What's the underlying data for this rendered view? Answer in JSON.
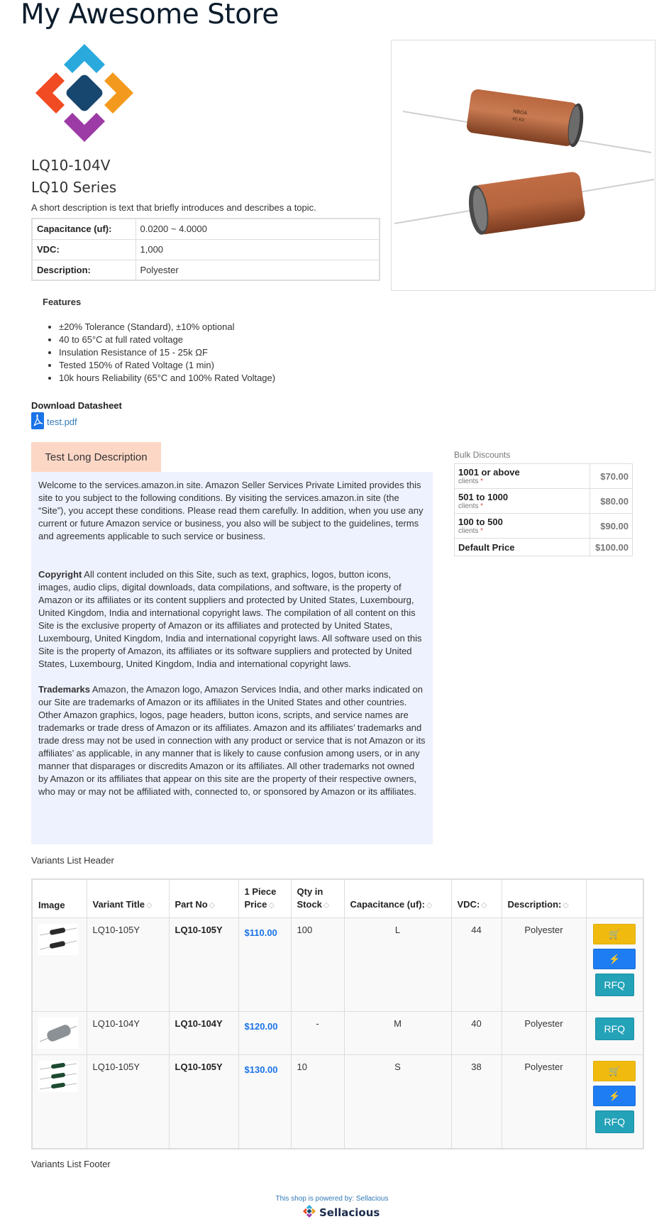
{
  "store": {
    "title": "My Awesome Store"
  },
  "product": {
    "name": "LQ10-104V",
    "series": "LQ10 Series",
    "short_description": "A short description is text that briefly introduces and describes a topic.",
    "attributes": [
      {
        "label": "Capacitance (uf):",
        "value": "0.0200 ~ 4.0000"
      },
      {
        "label": "VDC:",
        "value": "1,000"
      },
      {
        "label": "Description:",
        "value": "Polyester"
      }
    ]
  },
  "features": {
    "title": "Features",
    "items": [
      "±20% Tolerance (Standard), ±10% optional",
      "40 to 65°C at full rated voltage",
      "Insulation Resistance of 15 - 25k ΩF",
      "Tested 150% of Rated Voltage (1 min)",
      "10k hours Reliability (65°C and 100% Rated Voltage)"
    ]
  },
  "datasheet": {
    "title": "Download Datasheet",
    "file": "test.pdf"
  },
  "long_description": {
    "tab": "Test Long Description",
    "intro": "Welcome to the services.amazon.in site. Amazon Seller Services Private Limited provides this site to you subject to the following conditions. By visiting the services.amazon.in site (the “Site”), you accept these conditions. Please read them carefully. In addition, when you use any current or future Amazon service or business, you also will be subject to the guidelines, terms and agreements applicable to such service or business.",
    "copyright_label": "Copyright",
    "copyright_text": " All content included on this Site, such as text, graphics, logos, button icons, images, audio clips, digital downloads, data compilations, and software, is the property of Amazon or its affiliates or its content suppliers and protected by United States, Luxembourg, United Kingdom, India and international copyright laws. The compilation of all content on this Site is the exclusive property of Amazon or its affiliates and protected by United States, Luxembourg, United Kingdom, India and international copyright laws. All software used on this Site is the property of Amazon, its affiliates or its software suppliers and protected by United States, Luxembourg, United Kingdom, India and international copyright laws.",
    "trademarks_label": "Trademarks",
    "trademarks_text": " Amazon, the Amazon logo, Amazon Services India, and other marks indicated on our Site are trademarks of Amazon or its affiliates in the United States and other countries. Other Amazon graphics, logos, page headers, button icons, scripts, and service names are trademarks or trade dress of Amazon or its affiliates. Amazon and its affiliates’ trademarks and trade dress may not be used in connection with any product or service that is not Amazon or its affiliates’ as applicable, in any manner that is likely to cause confusion among users, or in any manner that disparages or discredits Amazon or its affiliates. All other trademarks not owned by Amazon or its affiliates that appear on this site are the property of their respective owners, who may or may not be affiliated with, connected to, or sponsored by Amazon or its affiliates."
  },
  "bulk": {
    "title": "Bulk Discounts",
    "sub_label": "clients",
    "rows": [
      {
        "qty": "1001 or above",
        "price": "$70.00"
      },
      {
        "qty": "501 to 1000",
        "price": "$80.00"
      },
      {
        "qty": "100 to 500",
        "price": "$90.00"
      }
    ],
    "default_label": "Default Price",
    "default_price": "$100.00"
  },
  "variants": {
    "header_text": "Variants List Header",
    "footer_text": "Variants List Footer",
    "columns": {
      "image": "Image",
      "title": "Variant Title",
      "part": "Part No",
      "price_line1": "1 Piece",
      "price_line2": "Price",
      "qty_line1": "Qty in",
      "qty_line2": "Stock",
      "cap": "Capacitance (uf):",
      "vdc": "VDC:",
      "desc": "Description:"
    },
    "rfq_label": "RFQ",
    "rows": [
      {
        "title": "LQ10-105Y",
        "part": "LQ10-105Y",
        "price": "$110.00",
        "qty": "100",
        "cap": "L",
        "vdc": "44",
        "desc": "Polyester"
      },
      {
        "title": "LQ10-104Y",
        "part": "LQ10-104Y",
        "price": "$120.00",
        "qty": "-",
        "cap": "M",
        "vdc": "40",
        "desc": "Polyester"
      },
      {
        "title": "LQ10-105Y",
        "part": "LQ10-105Y",
        "price": "$130.00",
        "qty": "10",
        "cap": "S",
        "vdc": "38",
        "desc": "Polyester"
      }
    ]
  },
  "footer": {
    "powered": "This shop is powered by: Sellacious",
    "brand": "Sellacious"
  },
  "colors": {
    "accent": "#1a73e8",
    "cart": "#f0ba0f",
    "buy": "#1e7df3",
    "rfq": "#23a2b8",
    "tab": "#fdd7c6",
    "desc_bg": "#eef2fe"
  }
}
